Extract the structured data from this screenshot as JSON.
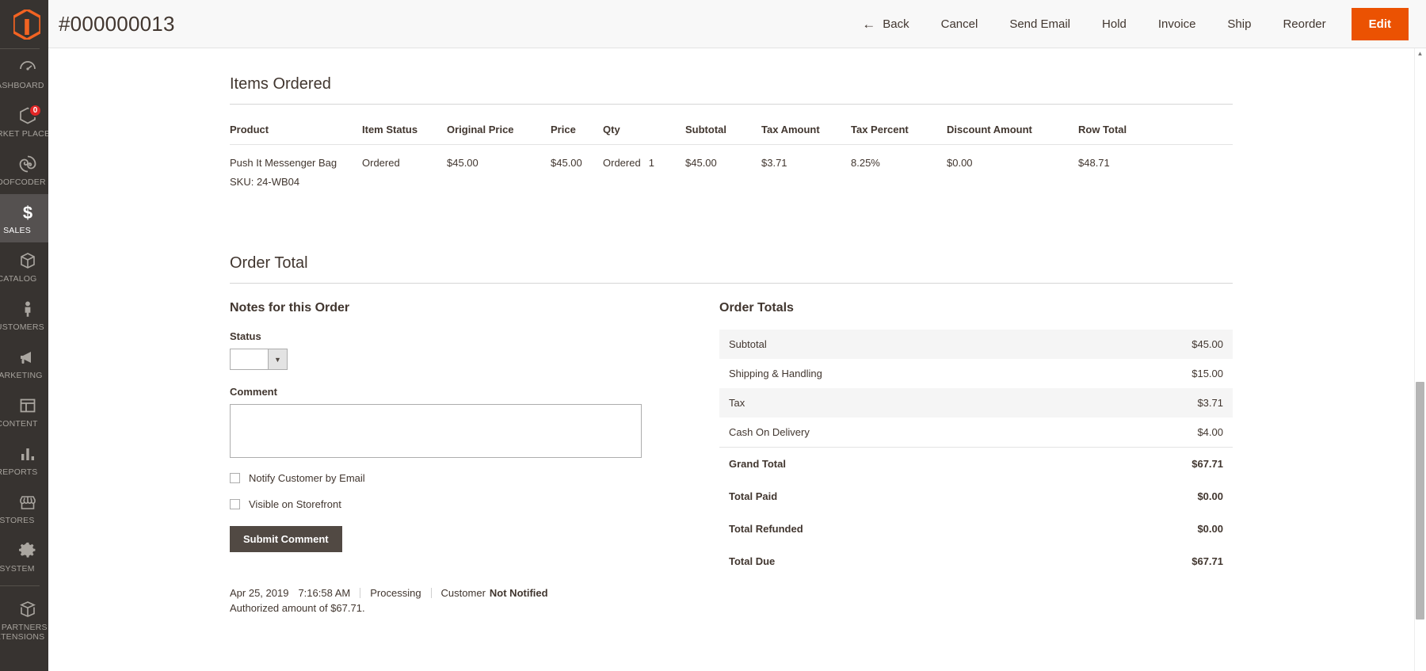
{
  "sidebar": {
    "logo": "magento-logo",
    "items": [
      {
        "label": "DASHBOARD",
        "icon": "dashboard-icon",
        "active": false,
        "badge": null
      },
      {
        "label": "MARKET PLACE",
        "icon": "hexagon-icon",
        "active": false,
        "badge": "0"
      },
      {
        "label": "INDOFCODER",
        "icon": "spiral-icon",
        "active": false,
        "badge": null
      },
      {
        "label": "SALES",
        "icon": "dollar-icon",
        "active": true,
        "badge": null
      },
      {
        "label": "CATALOG",
        "icon": "box-icon",
        "active": false,
        "badge": null
      },
      {
        "label": "CUSTOMERS",
        "icon": "person-icon",
        "active": false,
        "badge": null
      },
      {
        "label": "MARKETING",
        "icon": "megaphone-icon",
        "active": false,
        "badge": null
      },
      {
        "label": "CONTENT",
        "icon": "layout-icon",
        "active": false,
        "badge": null
      },
      {
        "label": "REPORTS",
        "icon": "bar-chart-icon",
        "active": false,
        "badge": null
      },
      {
        "label": "STORES",
        "icon": "storefront-icon",
        "active": false,
        "badge": null
      },
      {
        "label": "SYSTEM",
        "icon": "gear-icon",
        "active": false,
        "badge": null
      },
      {
        "label": "FIND PARTNERS & EXTENSIONS",
        "icon": "open-box-icon",
        "active": false,
        "badge": null
      }
    ]
  },
  "header": {
    "title": "#000000013",
    "actions": [
      {
        "label": "Back",
        "icon": "arrow-left-icon",
        "primary": false
      },
      {
        "label": "Cancel",
        "icon": null,
        "primary": false
      },
      {
        "label": "Send Email",
        "icon": null,
        "primary": false
      },
      {
        "label": "Hold",
        "icon": null,
        "primary": false
      },
      {
        "label": "Invoice",
        "icon": null,
        "primary": false
      },
      {
        "label": "Ship",
        "icon": null,
        "primary": false
      },
      {
        "label": "Reorder",
        "icon": null,
        "primary": false
      },
      {
        "label": "Edit",
        "icon": null,
        "primary": true
      }
    ],
    "primary_color": "#eb5202"
  },
  "items_ordered": {
    "title": "Items Ordered",
    "columns": [
      "Product",
      "Item Status",
      "Original Price",
      "Price",
      "Qty",
      "Subtotal",
      "Tax Amount",
      "Tax Percent",
      "Discount Amount",
      "Row Total"
    ],
    "rows": [
      {
        "product": "Push It Messenger Bag",
        "sku": "SKU: 24-WB04",
        "item_status": "Ordered",
        "original_price": "$45.00",
        "price": "$45.00",
        "qty_label": "Ordered",
        "qty_value": "1",
        "subtotal": "$45.00",
        "tax_amount": "$3.71",
        "tax_percent": "8.25%",
        "discount_amount": "$0.00",
        "row_total": "$48.71"
      }
    ]
  },
  "order_total": {
    "title": "Order Total",
    "notes": {
      "heading": "Notes for this Order",
      "status_label": "Status",
      "status_value": "",
      "comment_label": "Comment",
      "comment_value": "",
      "comment_placeholder": "",
      "notify_label": "Notify Customer by Email",
      "notify_checked": false,
      "visible_label": "Visible on Storefront",
      "visible_checked": false,
      "submit_label": "Submit Comment"
    },
    "history": [
      {
        "date": "Apr 25, 2019",
        "time": "7:16:58 AM",
        "status": "Processing",
        "customer_prefix": "Customer",
        "customer_state": "Not Notified",
        "body": "Authorized amount of $67.71."
      }
    ],
    "totals": {
      "heading": "Order Totals",
      "rows": [
        {
          "label": "Subtotal",
          "value": "$45.00",
          "striped": true,
          "strong": false,
          "topline": false
        },
        {
          "label": "Shipping & Handling",
          "value": "$15.00",
          "striped": false,
          "strong": false,
          "topline": false
        },
        {
          "label": "Tax",
          "value": "$3.71",
          "striped": true,
          "strong": false,
          "topline": false
        },
        {
          "label": "Cash On Delivery",
          "value": "$4.00",
          "striped": false,
          "strong": false,
          "topline": false
        },
        {
          "label": "Grand Total",
          "value": "$67.71",
          "striped": false,
          "strong": true,
          "topline": true
        },
        {
          "label": "Total Paid",
          "value": "$0.00",
          "striped": false,
          "strong": true,
          "topline": false
        },
        {
          "label": "Total Refunded",
          "value": "$0.00",
          "striped": false,
          "strong": true,
          "topline": false
        },
        {
          "label": "Total Due",
          "value": "$67.71",
          "striped": false,
          "strong": true,
          "topline": false
        }
      ]
    }
  }
}
